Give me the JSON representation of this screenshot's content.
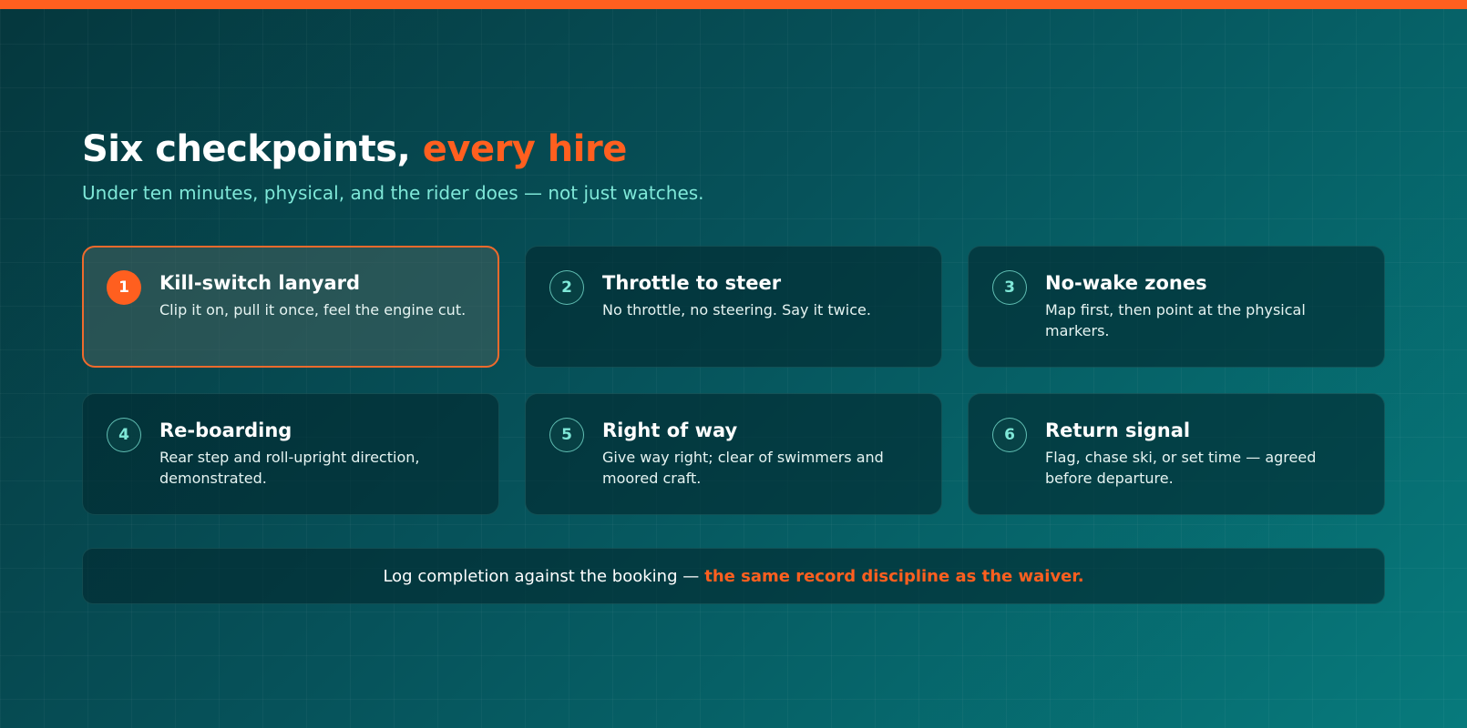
{
  "colors": {
    "accent": "#ff5f1f",
    "subtitle": "#7fe8d8",
    "background_start": "#05373d",
    "background_end": "#077a7c"
  },
  "header": {
    "title_main": "Six checkpoints, ",
    "title_accent": "every hire",
    "subtitle": "Under ten minutes, physical, and the rider does — not just watches."
  },
  "checkpoints": [
    {
      "number": "1",
      "title": "Kill-switch lanyard",
      "description": "Clip it on, pull it once, feel the engine cut.",
      "active": true
    },
    {
      "number": "2",
      "title": "Throttle to steer",
      "description": "No throttle, no steering. Say it twice.",
      "active": false
    },
    {
      "number": "3",
      "title": "No-wake zones",
      "description": "Map first, then point at the physical markers.",
      "active": false
    },
    {
      "number": "4",
      "title": "Re-boarding",
      "description": "Rear step and roll-upright direction, demonstrated.",
      "active": false
    },
    {
      "number": "5",
      "title": "Right of way",
      "description": "Give way right; clear of swimmers and moored craft.",
      "active": false
    },
    {
      "number": "6",
      "title": "Return signal",
      "description": "Flag, chase ski, or set time — agreed before departure.",
      "active": false
    }
  ],
  "footer": {
    "text": "Log completion against the booking —",
    "accent": "the same record discipline as the waiver."
  }
}
